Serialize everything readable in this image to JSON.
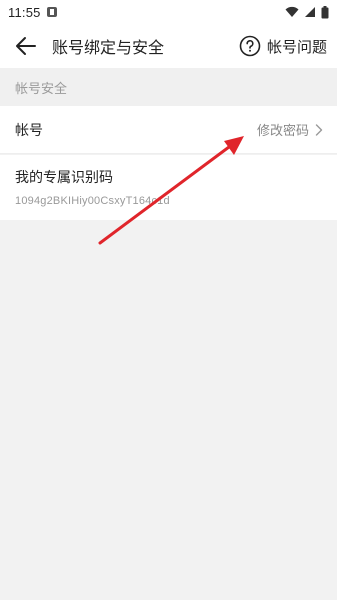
{
  "status_bar": {
    "time": "11:55"
  },
  "header": {
    "title": "账号绑定与安全",
    "help_label": "帐号问题"
  },
  "section": {
    "title": "帐号安全"
  },
  "account_row": {
    "label": "帐号",
    "action_label": "修改密码"
  },
  "code_row": {
    "label": "我的专属识别码",
    "value": "1094g2BKIHiy00CsxyT164c1d"
  },
  "colors": {
    "background": "#f2f2f2",
    "surface": "#ffffff",
    "annotation_arrow": "#e0252b",
    "muted_text": "#999999"
  },
  "icons": {
    "back": "arrow-left-icon",
    "help": "question-circle-icon",
    "chevron": "chevron-right-icon"
  }
}
